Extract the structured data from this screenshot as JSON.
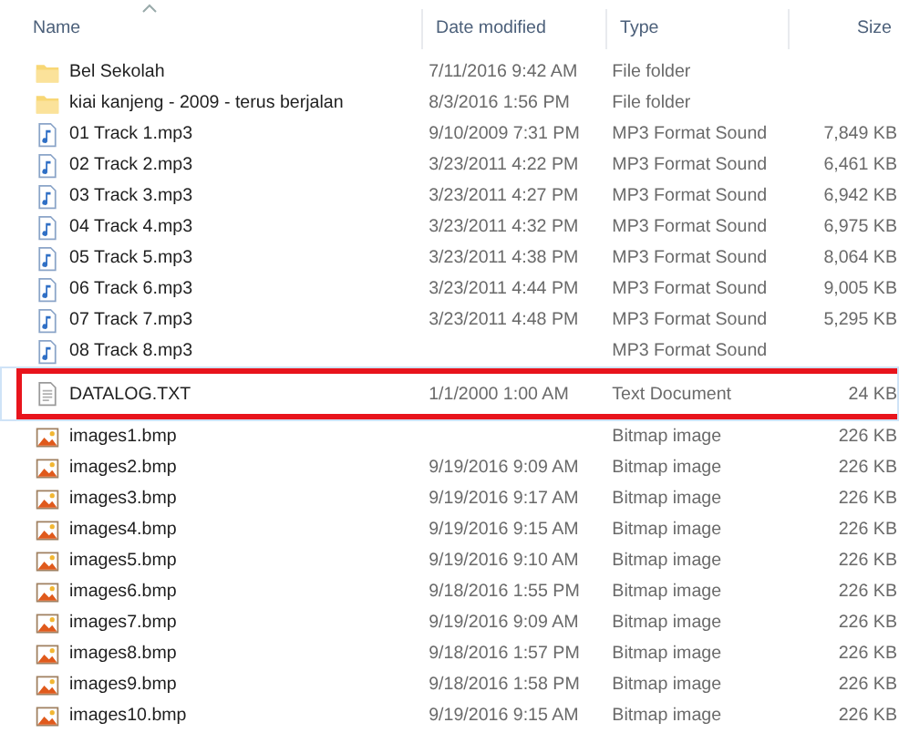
{
  "columns": [
    {
      "label": "Name",
      "sorted": true
    },
    {
      "label": "Date modified",
      "sorted": false
    },
    {
      "label": "Type",
      "sorted": false
    },
    {
      "label": "Size",
      "sorted": false
    }
  ],
  "rows": [
    {
      "kind": "folder",
      "name": "Bel Sekolah",
      "date": "7/11/2016 9:42 AM",
      "type": "File folder",
      "highlighted": false,
      "focused": false
    },
    {
      "kind": "folder",
      "name": "kiai kanjeng - 2009 - terus berjalan",
      "date": "8/3/2016 1:56 PM",
      "type": "File folder",
      "highlighted": false,
      "focused": false
    },
    {
      "kind": "audio",
      "name": "01 Track 1.mp3",
      "date": "9/10/2009 7:31 PM",
      "type": "MP3 Format Sound",
      "size": "7,849 KB",
      "highlighted": false,
      "focused": false
    },
    {
      "kind": "audio",
      "name": "02 Track 2.mp3",
      "date": "3/23/2011 4:22 PM",
      "type": "MP3 Format Sound",
      "size": "6,461 KB",
      "highlighted": false,
      "focused": false
    },
    {
      "kind": "audio",
      "name": "03 Track 3.mp3",
      "date": "3/23/2011 4:27 PM",
      "type": "MP3 Format Sound",
      "size": "6,942 KB",
      "highlighted": false,
      "focused": false
    },
    {
      "kind": "audio",
      "name": "04 Track 4.mp3",
      "date": "3/23/2011 4:32 PM",
      "type": "MP3 Format Sound",
      "size": "6,975 KB",
      "highlighted": false,
      "focused": false
    },
    {
      "kind": "audio",
      "name": "05 Track 5.mp3",
      "date": "3/23/2011 4:38 PM",
      "type": "MP3 Format Sound",
      "size": "8,064 KB",
      "highlighted": false,
      "focused": false
    },
    {
      "kind": "audio",
      "name": "06 Track 6.mp3",
      "date": "3/23/2011 4:44 PM",
      "type": "MP3 Format Sound",
      "size": "9,005 KB",
      "highlighted": false,
      "focused": false
    },
    {
      "kind": "audio",
      "name": "07 Track 7.mp3",
      "date": "3/23/2011 4:48 PM",
      "type": "MP3 Format Sound",
      "size": "5,295 KB",
      "highlighted": false,
      "focused": false
    },
    {
      "kind": "audio",
      "name": "08 Track 8.mp3",
      "type": "MP3 Format Sound",
      "highlighted": false,
      "focused": false
    },
    {
      "kind": "text",
      "name": "DATALOG.TXT",
      "date": "1/1/2000 1:00 AM",
      "type": "Text Document",
      "size": "24 KB",
      "highlighted": true,
      "focused": true
    },
    {
      "kind": "image",
      "name": "images1.bmp",
      "type": "Bitmap image",
      "size": "226 KB",
      "highlighted": false,
      "focused": false
    },
    {
      "kind": "image",
      "name": "images2.bmp",
      "date": "9/19/2016 9:09 AM",
      "type": "Bitmap image",
      "size": "226 KB",
      "highlighted": false,
      "focused": false
    },
    {
      "kind": "image",
      "name": "images3.bmp",
      "date": "9/19/2016 9:17 AM",
      "type": "Bitmap image",
      "size": "226 KB",
      "highlighted": false,
      "focused": false
    },
    {
      "kind": "image",
      "name": "images4.bmp",
      "date": "9/19/2016 9:15 AM",
      "type": "Bitmap image",
      "size": "226 KB",
      "highlighted": false,
      "focused": false
    },
    {
      "kind": "image",
      "name": "images5.bmp",
      "date": "9/19/2016 9:10 AM",
      "type": "Bitmap image",
      "size": "226 KB",
      "highlighted": false,
      "focused": false
    },
    {
      "kind": "image",
      "name": "images6.bmp",
      "date": "9/18/2016 1:55 PM",
      "type": "Bitmap image",
      "size": "226 KB",
      "highlighted": false,
      "focused": false
    },
    {
      "kind": "image",
      "name": "images7.bmp",
      "date": "9/19/2016 9:09 AM",
      "type": "Bitmap image",
      "size": "226 KB",
      "highlighted": false,
      "focused": false
    },
    {
      "kind": "image",
      "name": "images8.bmp",
      "date": "9/18/2016 1:57 PM",
      "type": "Bitmap image",
      "size": "226 KB",
      "highlighted": false,
      "focused": false
    },
    {
      "kind": "image",
      "name": "images9.bmp",
      "date": "9/18/2016 1:58 PM",
      "type": "Bitmap image",
      "size": "226 KB",
      "highlighted": false,
      "focused": false
    },
    {
      "kind": "image",
      "name": "images10.bmp",
      "date": "9/19/2016 9:15 AM",
      "type": "Bitmap image",
      "size": "226 KB",
      "highlighted": false,
      "focused": false
    }
  ]
}
